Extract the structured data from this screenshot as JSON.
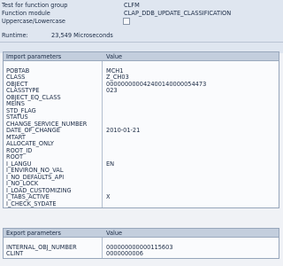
{
  "header": {
    "test_label": "Test for function group",
    "test_value": "CLFM",
    "module_label": "Function module",
    "module_value": "CLAP_DDB_UPDATE_CLASSIFICATION",
    "case_label": "Uppercase/Lowercase",
    "runtime_label": "Runtime:",
    "runtime_value": "23,549 Microseconds"
  },
  "import_table": {
    "col1": "Import parameters",
    "col2": "Value",
    "rows": [
      {
        "name": "",
        "value": ""
      },
      {
        "name": "POBTAB",
        "value": "MCH1"
      },
      {
        "name": "CLASS",
        "value": "Z_CH03"
      },
      {
        "name": "OBJECT",
        "value": "000000000042400140000054473"
      },
      {
        "name": "CLASSTYPE",
        "value": "023"
      },
      {
        "name": "OBJECT_EQ_CLASS",
        "value": ""
      },
      {
        "name": "MEINS",
        "value": ""
      },
      {
        "name": "STD_FLAG",
        "value": ""
      },
      {
        "name": "STATUS",
        "value": ""
      },
      {
        "name": "CHANGE_SERVICE_NUMBER",
        "value": ""
      },
      {
        "name": "DATE_OF_CHANGE",
        "value": "2010-01-21"
      },
      {
        "name": "MTART",
        "value": ""
      },
      {
        "name": "ALLOCATE_ONLY",
        "value": ""
      },
      {
        "name": "ROOT_ID",
        "value": ""
      },
      {
        "name": "ROOT",
        "value": ""
      },
      {
        "name": "I_LANGU",
        "value": "EN"
      },
      {
        "name": "I_ENVIRON_NO_VAL",
        "value": ""
      },
      {
        "name": "I_NO_DEFAULTS_API",
        "value": ""
      },
      {
        "name": "I_NO_LOCK",
        "value": ""
      },
      {
        "name": "I_LOAD_CUSTOMIZING",
        "value": ""
      },
      {
        "name": "I_TABS_ACTIVE",
        "value": "X"
      },
      {
        "name": "I_CHECK_SYDATE",
        "value": ""
      }
    ]
  },
  "export_table": {
    "col1": "Export parameters",
    "col2": "Value",
    "rows": [
      {
        "name": "",
        "value": ""
      },
      {
        "name": "INTERNAL_OBJ_NUMBER",
        "value": "000000000000115603"
      },
      {
        "name": "CLINT",
        "value": "0000000006"
      }
    ]
  }
}
